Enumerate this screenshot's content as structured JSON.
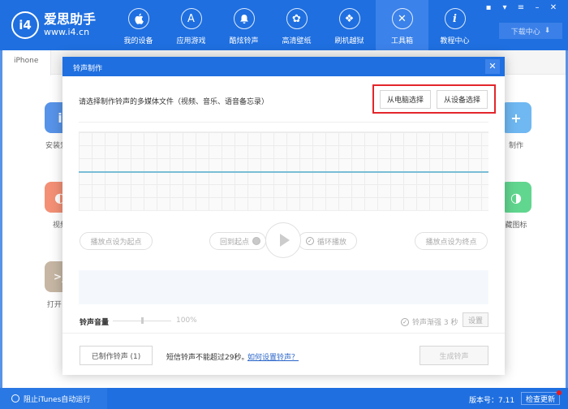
{
  "app": {
    "logo_mark": "i4",
    "name": "爱思助手",
    "url": "www.i4.cn"
  },
  "nav": [
    {
      "label": "我的设备",
      "icon": "apple-icon",
      "glyph": ""
    },
    {
      "label": "应用游戏",
      "icon": "app-store-icon",
      "glyph": "A"
    },
    {
      "label": "酷炫铃声",
      "icon": "bell-icon",
      "glyph": "🔔"
    },
    {
      "label": "高清壁纸",
      "icon": "flower-icon",
      "glyph": "✿"
    },
    {
      "label": "刷机越狱",
      "icon": "dropbox-icon",
      "glyph": "❖"
    },
    {
      "label": "工具箱",
      "icon": "tools-icon",
      "glyph": "✕",
      "active": true
    },
    {
      "label": "教程中心",
      "icon": "info-icon",
      "glyph": "i"
    }
  ],
  "window_controls": {
    "message": "▪",
    "skin": "▾",
    "menu": "≡",
    "minimize": "–",
    "close": "✕"
  },
  "download_center": {
    "label": "下载中心",
    "icon_glyph": "⬇"
  },
  "tabs": {
    "device": "iPhone"
  },
  "tiles": [
    {
      "label": "安装爱思",
      "glyph": "i",
      "color": "#1f6fe0"
    },
    {
      "label": "视频",
      "glyph": "◐",
      "color": "#ef6b47"
    },
    {
      "label": "打开 SS",
      "glyph": ">_",
      "color": "#b39e84"
    },
    {
      "label": "制作",
      "glyph": "+",
      "color": "#3fa0ee"
    },
    {
      "label": "藏图标",
      "glyph": "◑",
      "color": "#2dc86a"
    }
  ],
  "modal": {
    "title": "铃声制作",
    "close_glyph": "✕",
    "prompt": "请选择制作铃声的多媒体文件（视频、音乐、语音备忘录）",
    "select_from_pc": "从电脑选择",
    "select_from_device": "从设备选择",
    "set_start": "播放点设为起点",
    "back_to_start": "回到起点",
    "loop_play": "循环播放",
    "set_end": "播放点设为终点",
    "volume_label": "铃声音量",
    "volume_value": "100%",
    "volume_level": 0.5,
    "fade_label": "铃声渐强 3 秒",
    "settings": "设置",
    "made_ringtones": "已制作铃声 (1)",
    "sms_note": "短信铃声不能超过29秒。",
    "how_to": "如何设置铃声？",
    "generate": "生成铃声"
  },
  "footer": {
    "block_itunes": "阻止iTunes自动运行",
    "version": "版本号：7.11",
    "check_update": "检查更新"
  },
  "colors": {
    "brand_blue": "#1f6fe0",
    "highlight_red": "#e3262b",
    "waveform_line": "#7bbdd6",
    "link": "#2b66c9"
  }
}
